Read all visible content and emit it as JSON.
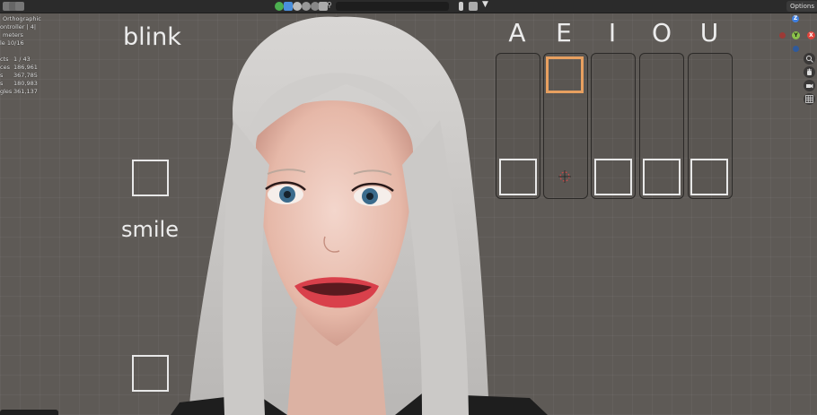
{
  "stats": {
    "rows": [
      {
        "key": "",
        "value": "Orthographic"
      },
      {
        "key": "",
        "value": "ontroller | 4|"
      },
      {
        "key": "",
        "value": "meters"
      },
      {
        "key": "",
        "value": "le 10/16"
      },
      {
        "key": "",
        "value": ""
      },
      {
        "key": "cts",
        "value": "1 / 43"
      },
      {
        "key": "ces",
        "value": "186,961"
      },
      {
        "key": "s",
        "value": "367,785"
      },
      {
        "key": "s",
        "value": "180,983"
      },
      {
        "key": "gles",
        "value": "361,137"
      }
    ]
  },
  "header": {
    "options_label": "Options",
    "search_placeholder": ""
  },
  "rig": {
    "blink_label": "blink",
    "smile_label": "smile",
    "vowels": [
      "A",
      "E",
      "I",
      "O",
      "U"
    ]
  },
  "gizmo": {
    "z_label": "Z",
    "y_label": "Y",
    "x_label": "X"
  },
  "colors": {
    "background": "#5e5a56",
    "active_control": "#e8a060",
    "x_axis": "#e0443b",
    "y_axis": "#8bc34a",
    "z_axis": "#3f7fe0"
  }
}
